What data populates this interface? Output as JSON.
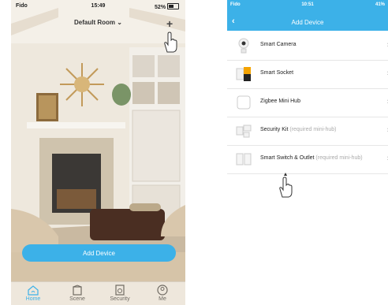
{
  "left_phone": {
    "status": {
      "carrier": "Fido",
      "time": "15:49",
      "battery": "52%",
      "battery_level": 0.52
    },
    "room_selector": "Default Room",
    "add_button": "Add Device",
    "tabs": [
      {
        "label": "Home",
        "icon": "home-icon",
        "active": true
      },
      {
        "label": "Scene",
        "icon": "scene-icon",
        "active": false
      },
      {
        "label": "Security",
        "icon": "security-icon",
        "active": false
      },
      {
        "label": "Me",
        "icon": "me-icon",
        "active": false
      }
    ]
  },
  "right_phone": {
    "status": {
      "carrier": "Fido",
      "time": "10:51",
      "battery": "41%"
    },
    "title": "Add Device",
    "devices": [
      {
        "name": "Smart Camera",
        "note": "",
        "icon": "camera-icon"
      },
      {
        "name": "Smart Socket",
        "note": "",
        "icon": "socket-icon"
      },
      {
        "name": "Zigbee Mini Hub",
        "note": "",
        "icon": "hub-icon"
      },
      {
        "name": "Security Kit",
        "note": "(required mini-hub)",
        "icon": "security-kit-icon"
      },
      {
        "name": "Smart Switch & Outlet",
        "note": "(required mini-hub)",
        "icon": "switch-outlet-icon"
      }
    ]
  },
  "colors": {
    "accent": "#3cb1e8",
    "header_bg": "#3cb1e8"
  }
}
